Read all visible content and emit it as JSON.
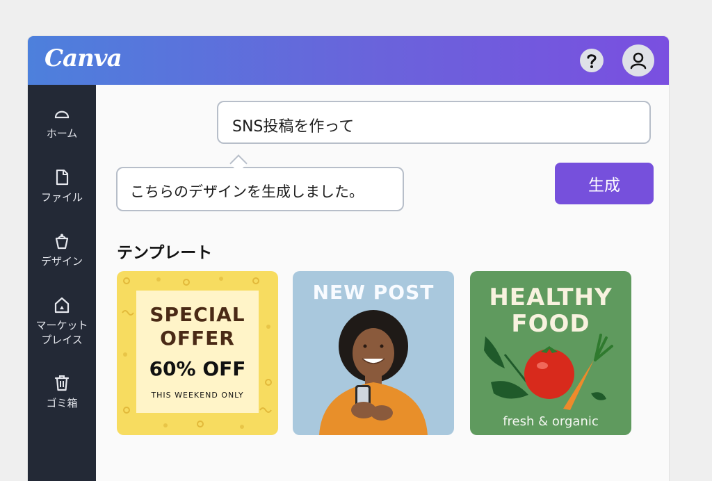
{
  "header": {
    "logo_text": "Canva",
    "help_icon": "question-mark-icon",
    "avatar_icon": "user-icon",
    "gradient_start": "#4d80dc",
    "gradient_end": "#7a4fe0"
  },
  "sidebar": {
    "items": [
      {
        "label": "ホーム",
        "icon": "home-icon"
      },
      {
        "label": "ファイル",
        "icon": "file-icon"
      },
      {
        "label": "デザイン",
        "icon": "bucket-icon"
      },
      {
        "label": "マーケット\nプレイス",
        "icon": "marketplace-icon"
      },
      {
        "label": "ゴミ箱",
        "icon": "trash-icon"
      }
    ]
  },
  "chat": {
    "prompt_text": "SNS投稿を作って",
    "reply_text": "こちらのデザインを生成しました。",
    "generate_label": "生成",
    "accent": "#7650dc"
  },
  "templates": {
    "title": "テンプレート",
    "cards": [
      {
        "line1": "SPECIAL",
        "line2": "OFFER",
        "line3": "60% OFF",
        "line4": "THIS WEEKEND ONLY"
      },
      {
        "title": "NEW POST"
      },
      {
        "line1": "HEALTHY",
        "line2": "FOOD",
        "sub": "fresh & organic"
      }
    ]
  }
}
